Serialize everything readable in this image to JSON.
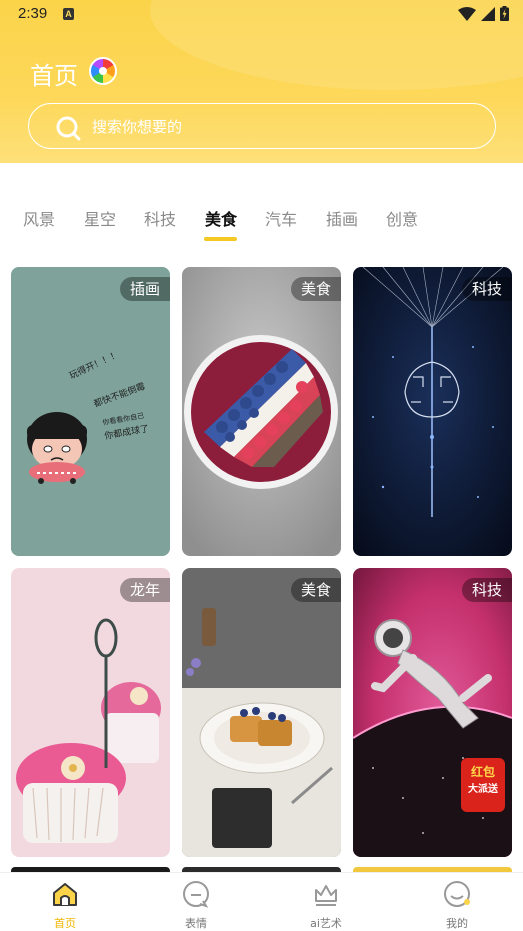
{
  "status_bar": {
    "time": "2:39",
    "notification_icon": "A"
  },
  "header": {
    "title": "首页",
    "logo_icon": "color-wheel-icon",
    "search_placeholder": "搜索你想要的"
  },
  "tabs": [
    {
      "label": "风景",
      "active": false
    },
    {
      "label": "星空",
      "active": false
    },
    {
      "label": "科技",
      "active": false
    },
    {
      "label": "美食",
      "active": true
    },
    {
      "label": "汽车",
      "active": false
    },
    {
      "label": "插画",
      "active": false
    },
    {
      "label": "创意",
      "active": false
    }
  ],
  "cards": [
    {
      "tag": "插画",
      "image": "cartoon-girl-illustration"
    },
    {
      "tag": "美食",
      "image": "berry-smoothie-bowl"
    },
    {
      "tag": "科技",
      "image": "glowing-circuit-tree"
    },
    {
      "tag": "龙年",
      "image": "pink-cupcakes"
    },
    {
      "tag": "美食",
      "image": "waffles-with-blueberries"
    },
    {
      "tag": "科技",
      "image": "floating-astronaut"
    }
  ],
  "card3_2_badge": {
    "line1": "红包",
    "line2": "大派送"
  },
  "cartoon_text": [
    "玩得开！！！",
    "都快不能倒霉",
    "你看看你自己",
    "你都成球了"
  ],
  "bottom_nav": [
    {
      "label": "首页",
      "icon": "home-icon",
      "active": true
    },
    {
      "label": "表情",
      "icon": "emoji-icon",
      "active": false
    },
    {
      "label": "ai艺术",
      "icon": "crown-icon",
      "active": false
    },
    {
      "label": "我的",
      "icon": "profile-icon",
      "active": false
    }
  ],
  "colors": {
    "accent": "#f6c824",
    "header_bg": "#fdd85a",
    "active_nav": "#f2b600"
  }
}
